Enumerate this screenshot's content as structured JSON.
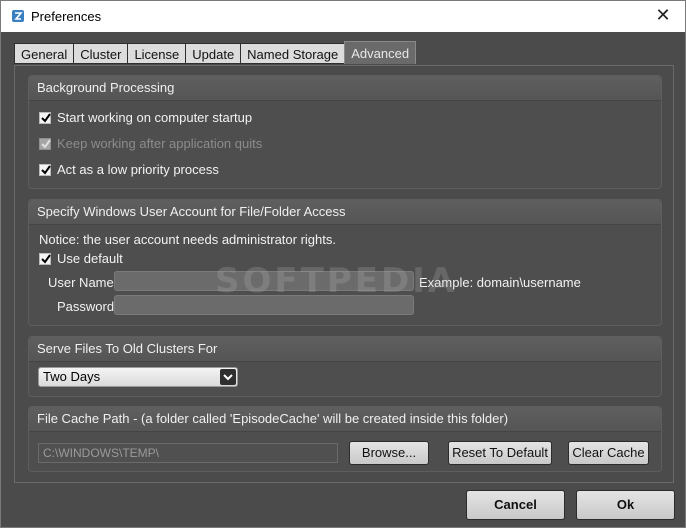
{
  "window": {
    "title": "Preferences",
    "close_glyph": "✕"
  },
  "tabs": [
    {
      "label": "General"
    },
    {
      "label": "Cluster"
    },
    {
      "label": "License"
    },
    {
      "label": "Update"
    },
    {
      "label": "Named Storage"
    },
    {
      "label": "Advanced",
      "active": true
    }
  ],
  "background_processing": {
    "title": "Background Processing",
    "options": [
      {
        "label": "Start working on computer startup",
        "checked": true,
        "enabled": true
      },
      {
        "label": "Keep working after application quits",
        "checked": true,
        "enabled": false
      },
      {
        "label": "Act as a low priority process",
        "checked": true,
        "enabled": true
      }
    ]
  },
  "user_account": {
    "title": "Specify Windows User Account for File/Folder Access",
    "notice": "Notice: the user account needs administrator rights.",
    "use_default_label": "Use default",
    "use_default_checked": true,
    "username_label": "User Name:",
    "username_value": "",
    "example_text": "Example: domain\\username",
    "password_label": "Password:",
    "password_value": ""
  },
  "serve_files": {
    "title": "Serve Files To Old Clusters For",
    "selected": "Two Days"
  },
  "file_cache": {
    "title": "File Cache Path - (a folder called 'EpisodeCache' will be created inside this folder)",
    "path_value": "C:\\WINDOWS\\TEMP\\",
    "browse_label": "Browse...",
    "reset_label": "Reset To Default",
    "clear_label": "Clear Cache"
  },
  "footer": {
    "cancel_label": "Cancel",
    "ok_label": "Ok"
  },
  "watermark": "SOFTPEDIA",
  "colors": {
    "window_bg": "#4b4b4b",
    "titlebar_bg": "#ffffff",
    "group_bg": "#4e4e4e",
    "text": "#f2f2f2"
  }
}
